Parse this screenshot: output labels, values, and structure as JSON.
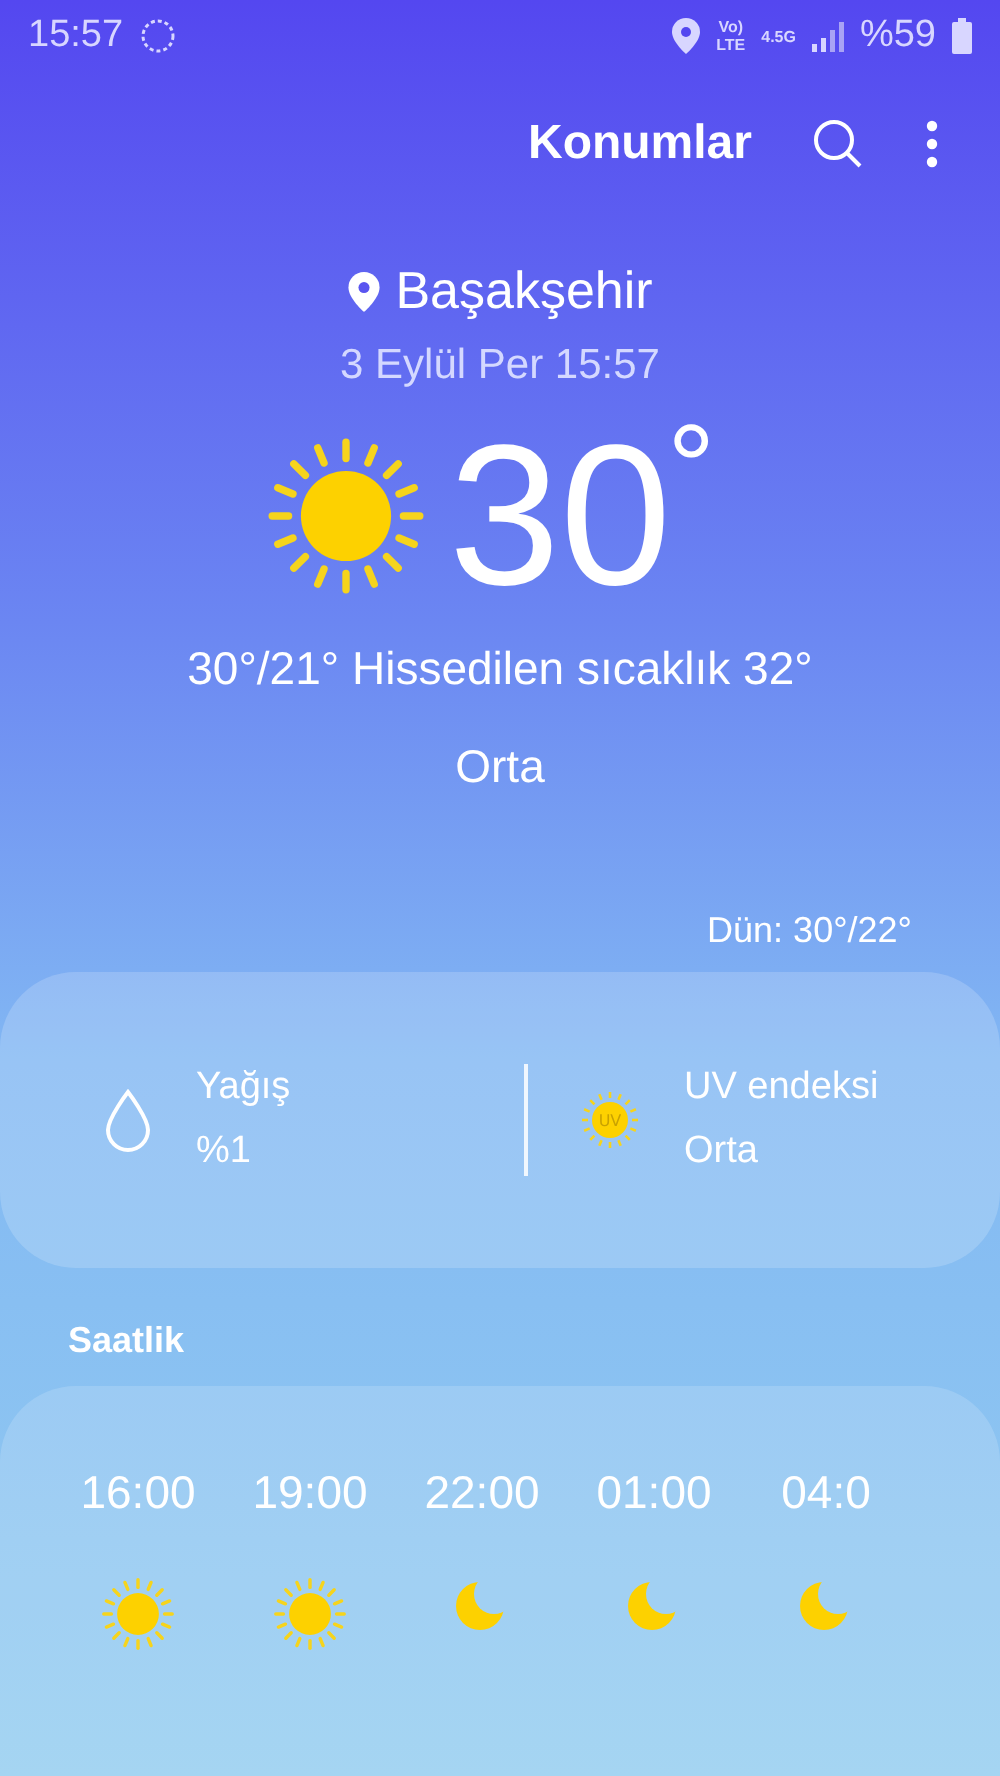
{
  "status_bar": {
    "time": "15:57",
    "network_top": "Vo)",
    "network_bottom": "LTE",
    "data_type": "4.5G",
    "battery": "%59"
  },
  "header": {
    "title": "Konumlar"
  },
  "location": {
    "name": "Başakşehir",
    "datetime": "3 Eylül Per 15:57"
  },
  "current": {
    "kind": "sun",
    "temperature": "30",
    "degree": "°",
    "summary": "30°/21° Hissedilen sıcaklık 32°",
    "air_quality": "Orta",
    "yesterday": "Dün: 30°/22°"
  },
  "details": [
    {
      "kind": "rain",
      "label": "Yağış",
      "value": "%1"
    },
    {
      "kind": "uv",
      "label": "UV endeksi",
      "value": "Orta",
      "badge": "UV"
    }
  ],
  "hourly": {
    "title": "Saatlik",
    "items": [
      {
        "time": "16:00",
        "kind": "sun"
      },
      {
        "time": "19:00",
        "kind": "sun"
      },
      {
        "time": "22:00",
        "kind": "moon"
      },
      {
        "time": "01:00",
        "kind": "moon"
      },
      {
        "time": "04:0",
        "kind": "moon"
      }
    ]
  }
}
